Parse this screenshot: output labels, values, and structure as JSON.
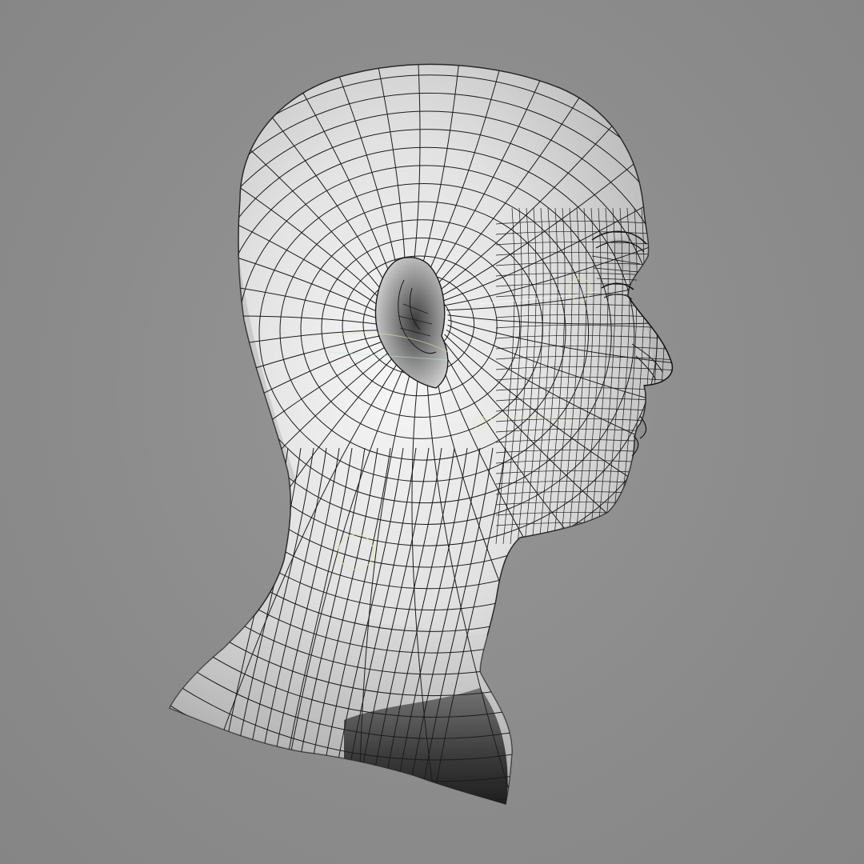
{
  "scene": {
    "description_free": true,
    "background_color": "#8e8e8e",
    "mesh_fill_light": "#f2f2f2",
    "mesh_fill_mid": "#c9c9c9",
    "mesh_fill_dark": "#1a1a1a",
    "wire_color": "#1b1b1b",
    "helper_color_yellow": "#e6e69a",
    "helper_color_cyan": "#b9e3ea",
    "model_icon": "head-wireframe-mesh"
  }
}
